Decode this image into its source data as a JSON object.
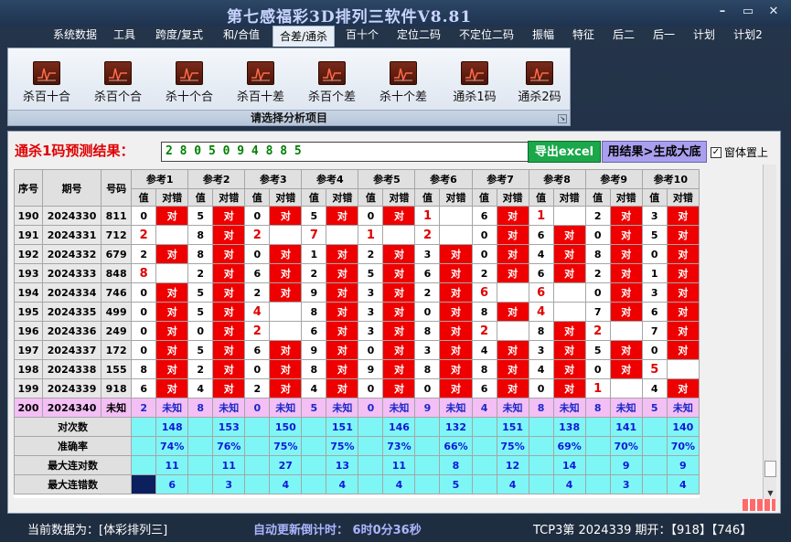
{
  "titlebar": {
    "title": "第七感福彩3D排列三软件V8.81",
    "minimize": "–",
    "restore": "▭",
    "close": "✕"
  },
  "menu": [
    "系统数据",
    "工具",
    "跨度/复式",
    "和/合值",
    "合差/通杀",
    "百十个",
    "定位二码",
    "不定位二码",
    "振幅",
    "特征",
    "后二",
    "后一",
    "计划",
    "计划2"
  ],
  "menu_active_index": 4,
  "ribbon": {
    "buttons": [
      "杀百十合",
      "杀百个合",
      "杀十个合",
      "杀百十差",
      "杀百个差",
      "杀十个差",
      "通杀1码",
      "通杀2码"
    ],
    "caption": "请选择分析项目"
  },
  "result": {
    "label": "通杀1码预测结果：",
    "value": "2 8 0 5 0 9 4 8 8 5",
    "export_label": "导出excel",
    "use_label": "用结果>生成大底",
    "ontop_label": "窗体置上",
    "ontop_checked": "✓"
  },
  "table": {
    "col_seq": "序号",
    "col_issue": "期号",
    "col_code": "号码",
    "groups": [
      "参考1",
      "参考2",
      "参考3",
      "参考4",
      "参考5",
      "参考6",
      "参考7",
      "参考8",
      "参考9",
      "参考10"
    ],
    "sub_value": "值",
    "sub_result": "对错",
    "right_mark": "对",
    "unknown": "未知",
    "rows": [
      {
        "seq": "190",
        "issue": "2024330",
        "code": "811",
        "cells": [
          [
            "0",
            1
          ],
          [
            "5",
            1
          ],
          [
            "0",
            1
          ],
          [
            "5",
            1
          ],
          [
            "0",
            1
          ],
          [
            "1",
            -1
          ],
          [
            "6",
            1
          ],
          [
            "1",
            -1
          ],
          [
            "2",
            1
          ],
          [
            "3",
            1
          ]
        ]
      },
      {
        "seq": "191",
        "issue": "2024331",
        "code": "712",
        "cells": [
          [
            "2",
            -1
          ],
          [
            "8",
            1
          ],
          [
            "2",
            -1
          ],
          [
            "7",
            -1
          ],
          [
            "1",
            -1
          ],
          [
            "2",
            -1
          ],
          [
            "0",
            1
          ],
          [
            "6",
            1
          ],
          [
            "0",
            1
          ],
          [
            "5",
            1
          ]
        ]
      },
      {
        "seq": "192",
        "issue": "2024332",
        "code": "679",
        "cells": [
          [
            "2",
            1
          ],
          [
            "8",
            1
          ],
          [
            "0",
            1
          ],
          [
            "1",
            1
          ],
          [
            "2",
            1
          ],
          [
            "3",
            1
          ],
          [
            "0",
            1
          ],
          [
            "4",
            1
          ],
          [
            "8",
            1
          ],
          [
            "0",
            1
          ]
        ]
      },
      {
        "seq": "193",
        "issue": "2024333",
        "code": "848",
        "cells": [
          [
            "8",
            -1
          ],
          [
            "2",
            1
          ],
          [
            "6",
            1
          ],
          [
            "2",
            1
          ],
          [
            "5",
            1
          ],
          [
            "6",
            1
          ],
          [
            "2",
            1
          ],
          [
            "6",
            1
          ],
          [
            "2",
            1
          ],
          [
            "1",
            1
          ]
        ]
      },
      {
        "seq": "194",
        "issue": "2024334",
        "code": "746",
        "cells": [
          [
            "0",
            1
          ],
          [
            "5",
            1
          ],
          [
            "2",
            1
          ],
          [
            "9",
            1
          ],
          [
            "3",
            1
          ],
          [
            "2",
            1
          ],
          [
            "6",
            -1
          ],
          [
            "6",
            -1
          ],
          [
            "0",
            1
          ],
          [
            "3",
            1
          ]
        ]
      },
      {
        "seq": "195",
        "issue": "2024335",
        "code": "499",
        "cells": [
          [
            "0",
            1
          ],
          [
            "5",
            1
          ],
          [
            "4",
            -1
          ],
          [
            "8",
            1
          ],
          [
            "3",
            1
          ],
          [
            "0",
            1
          ],
          [
            "8",
            1
          ],
          [
            "4",
            -1
          ],
          [
            "7",
            1
          ],
          [
            "6",
            1
          ]
        ]
      },
      {
        "seq": "196",
        "issue": "2024336",
        "code": "249",
        "cells": [
          [
            "0",
            1
          ],
          [
            "0",
            1
          ],
          [
            "2",
            -1
          ],
          [
            "6",
            1
          ],
          [
            "3",
            1
          ],
          [
            "8",
            1
          ],
          [
            "2",
            -1
          ],
          [
            "8",
            1
          ],
          [
            "2",
            -1
          ],
          [
            "7",
            1
          ]
        ]
      },
      {
        "seq": "197",
        "issue": "2024337",
        "code": "172",
        "cells": [
          [
            "0",
            1
          ],
          [
            "5",
            1
          ],
          [
            "6",
            1
          ],
          [
            "9",
            1
          ],
          [
            "0",
            1
          ],
          [
            "3",
            1
          ],
          [
            "4",
            1
          ],
          [
            "3",
            1
          ],
          [
            "5",
            1
          ],
          [
            "0",
            1
          ]
        ]
      },
      {
        "seq": "198",
        "issue": "2024338",
        "code": "155",
        "cells": [
          [
            "8",
            1
          ],
          [
            "2",
            1
          ],
          [
            "0",
            1
          ],
          [
            "8",
            1
          ],
          [
            "9",
            1
          ],
          [
            "8",
            1
          ],
          [
            "8",
            1
          ],
          [
            "4",
            1
          ],
          [
            "0",
            1
          ],
          [
            "5",
            -1
          ]
        ]
      },
      {
        "seq": "199",
        "issue": "2024339",
        "code": "918",
        "cells": [
          [
            "6",
            1
          ],
          [
            "4",
            1
          ],
          [
            "2",
            1
          ],
          [
            "4",
            1
          ],
          [
            "0",
            1
          ],
          [
            "0",
            1
          ],
          [
            "6",
            1
          ],
          [
            "0",
            1
          ],
          [
            "1",
            -1
          ],
          [
            "4",
            1
          ]
        ]
      }
    ],
    "pred": {
      "seq": "200",
      "issue": "2024340",
      "code": "未知",
      "values": [
        "2",
        "8",
        "0",
        "5",
        "0",
        "9",
        "4",
        "8",
        "8",
        "5"
      ]
    },
    "stats": [
      {
        "label": "对次数",
        "values": [
          "148",
          "153",
          "150",
          "151",
          "146",
          "132",
          "151",
          "138",
          "141",
          "140"
        ]
      },
      {
        "label": "准确率",
        "values": [
          "74%",
          "76%",
          "75%",
          "75%",
          "73%",
          "66%",
          "75%",
          "69%",
          "70%",
          "70%"
        ]
      },
      {
        "label": "最大连对数",
        "values": [
          "11",
          "11",
          "27",
          "13",
          "11",
          "8",
          "12",
          "14",
          "9",
          "9"
        ]
      },
      {
        "label": "最大连错数",
        "values": [
          "6",
          "3",
          "4",
          "4",
          "4",
          "5",
          "4",
          "4",
          "3",
          "4"
        ]
      }
    ]
  },
  "status": {
    "source": "当前数据为：[体彩排列三]",
    "countdown": "自动更新倒计时：  6时0分36秒",
    "issue": "TCP3第  2024339  期开：【918】【746】"
  }
}
